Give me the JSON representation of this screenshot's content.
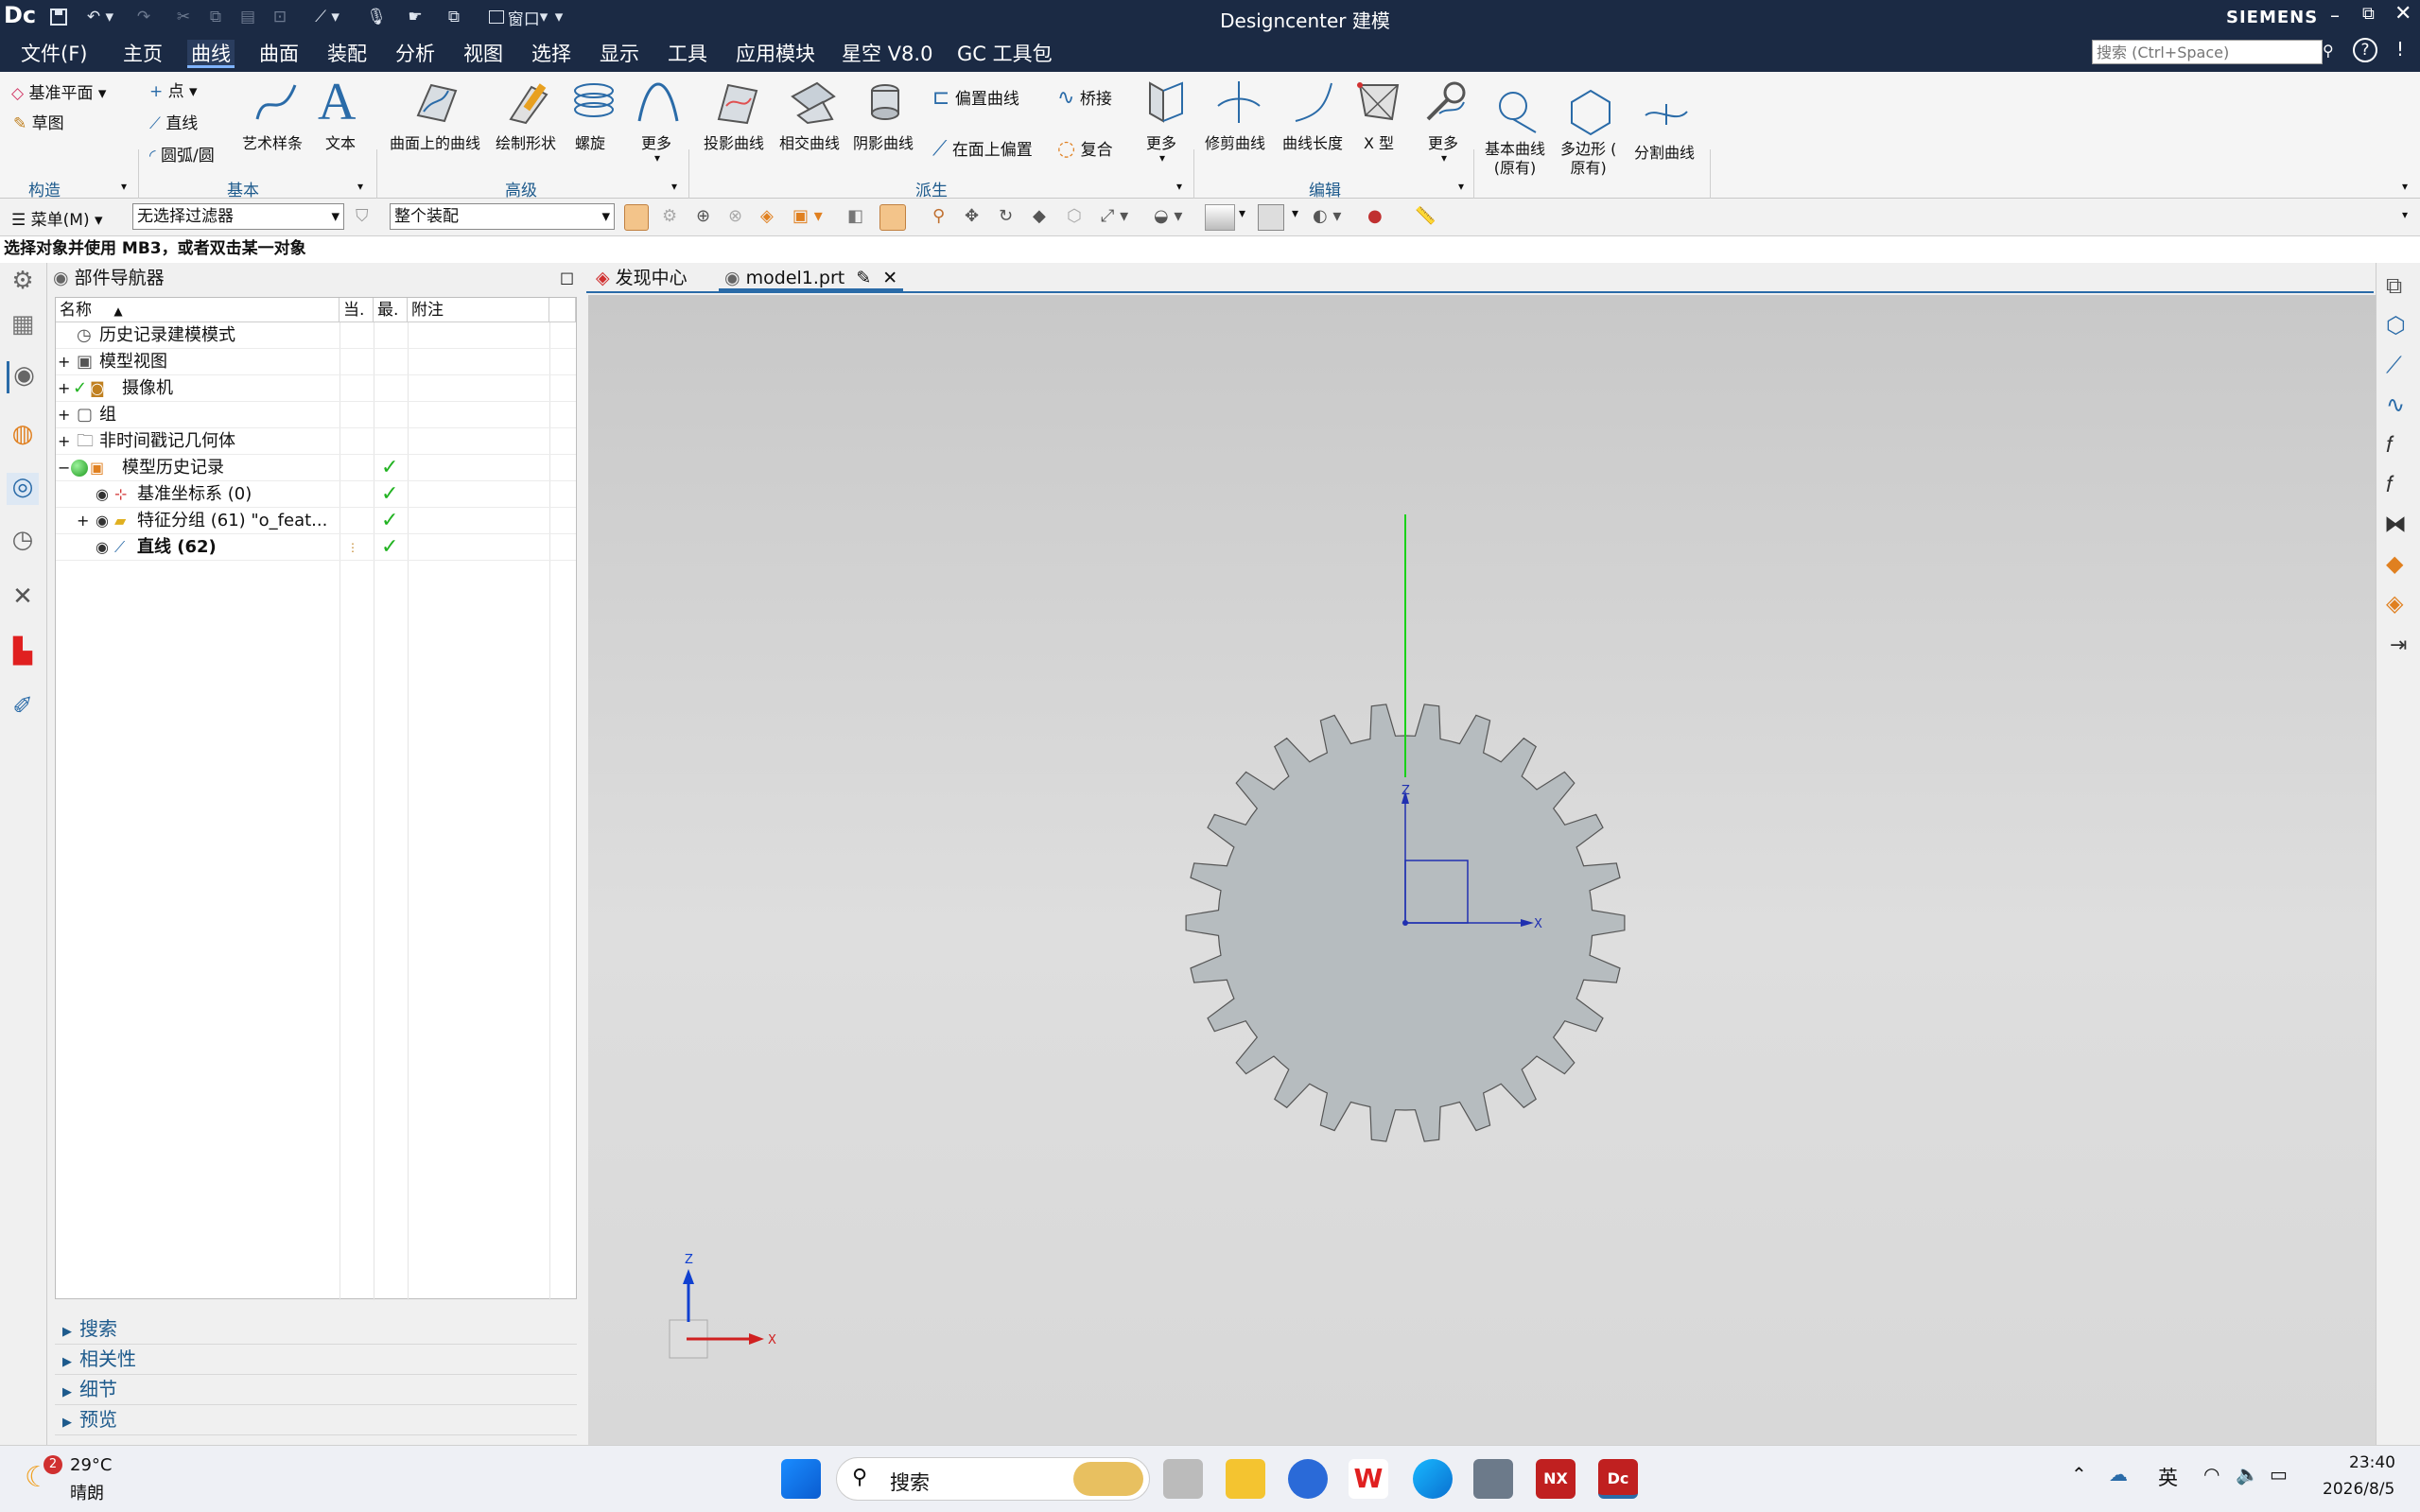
{
  "title_bar": {
    "app_icon": "Dc",
    "window_label": "窗口",
    "title": "Designcenter 建模",
    "brand": "SIEMENS"
  },
  "menu": {
    "items": [
      "文件(F)",
      "主页",
      "曲线",
      "曲面",
      "装配",
      "分析",
      "视图",
      "选择",
      "显示",
      "工具",
      "应用模块",
      "星空 V8.0",
      "GC 工具包"
    ],
    "active": "曲线",
    "search_placeholder": "搜索 (Ctrl+Space)"
  },
  "ribbon": {
    "construct": {
      "items": [
        "基准平面",
        "草图"
      ],
      "label": "构造"
    },
    "basic": {
      "items": [
        "点",
        "直线",
        "圆弧/圆",
        "艺术样条",
        "文本"
      ],
      "label": "基本"
    },
    "advanced": {
      "items": [
        "曲面上的曲线",
        "绘制形状",
        "螺旋",
        "更多"
      ],
      "label": "高级"
    },
    "derived": {
      "items": [
        "投影曲线",
        "相交曲线",
        "阴影曲线",
        "偏置曲线",
        "在面上偏置",
        "桥接",
        "复合",
        "更多"
      ],
      "label": "派生"
    },
    "edit": {
      "items": [
        "修剪曲线",
        "曲线长度",
        "X 型",
        "更多"
      ],
      "label": "编辑"
    },
    "extra": {
      "items": [
        "基本曲线\n(原有)",
        "多边形 (\n原有)",
        "分割曲线"
      ]
    }
  },
  "toolbar2": {
    "menu_label": "菜单(M)",
    "filter_value": "无选择过滤器",
    "scope_value": "整个装配"
  },
  "status_line": "选择对象并使用 MB3，或者双击某一对象",
  "navigator": {
    "title": "部件导航器",
    "columns": [
      "名称",
      "当.",
      "最.",
      "附注"
    ],
    "rows": [
      {
        "name": "历史记录建模模式"
      },
      {
        "name": "模型视图"
      },
      {
        "name": "摄像机"
      },
      {
        "name": "组"
      },
      {
        "name": "非时间戳记几何体"
      },
      {
        "name": "模型历史记录"
      },
      {
        "name": "基准坐标系 (0)"
      },
      {
        "name": "特征分组 (61) \"o_feat..."
      },
      {
        "name": "直线 (62)"
      }
    ],
    "sections": [
      "搜索",
      "相关性",
      "细节",
      "预览"
    ]
  },
  "tabs": [
    {
      "label": "发现中心"
    },
    {
      "label": "model1.prt"
    }
  ],
  "viewport": {
    "axis_z": "Z",
    "axis_x": "X",
    "triad_z": "Z",
    "triad_x": "X"
  },
  "taskbar": {
    "weather_temp": "29°C",
    "weather_desc": "晴朗",
    "weather_badge": "2",
    "search_label": "搜索",
    "ime": "英",
    "time": "23:40",
    "date": "2026/8/5"
  },
  "colors": {
    "titlebar": "#1b2a44",
    "accent": "#2a6ba8",
    "gear_fill": "#b6bcbf",
    "check_green": "#22b322"
  }
}
